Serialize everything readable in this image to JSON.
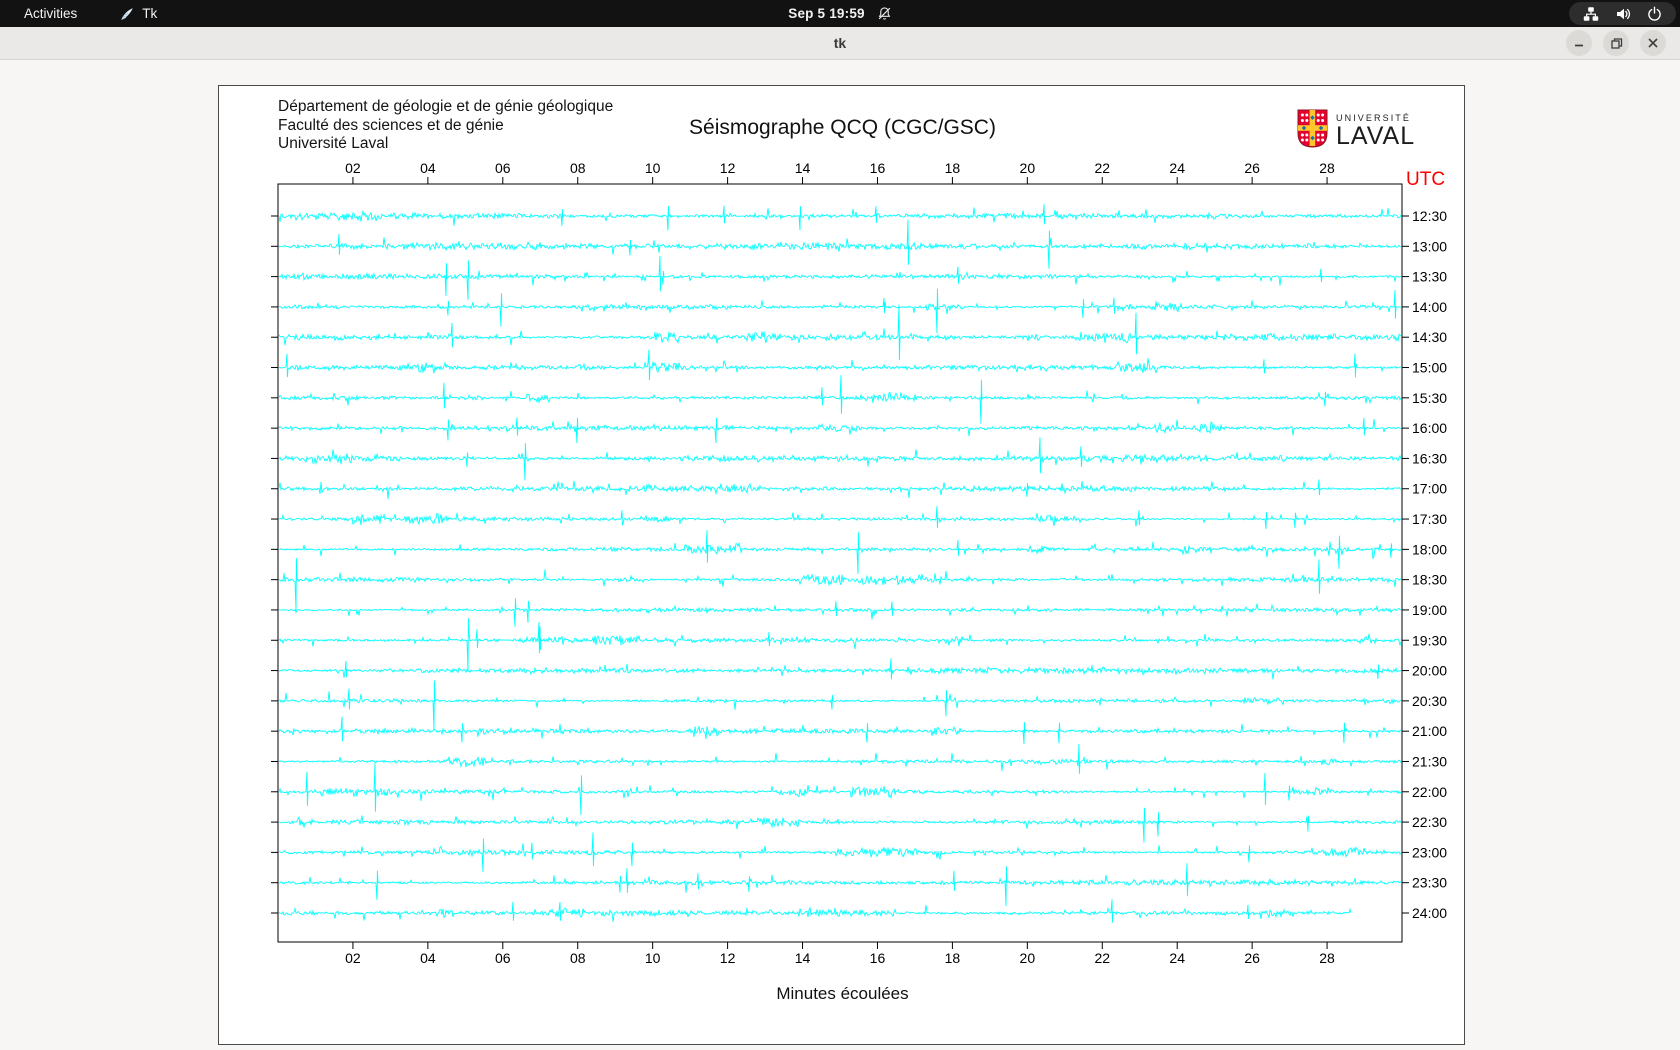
{
  "topbar": {
    "activities_label": "Activities",
    "app_menu_label": "Tk",
    "clock": "Sep 5 19:59",
    "icons": [
      "tk-feather-icon",
      "bell-muted-icon",
      "network-tree-icon",
      "speaker-icon",
      "power-icon"
    ]
  },
  "titlebar": {
    "title": "tk",
    "buttons": [
      "minimize",
      "maximize",
      "close"
    ]
  },
  "window": {
    "header_lines": [
      "Département de géologie et de génie géologique",
      "Faculté des sciences et de génie",
      "Université Laval"
    ],
    "chart_title": "Séismographe QCQ (CGC/GSC)",
    "logo_top": "UNIVERSITÉ",
    "logo_bottom": "LAVAL",
    "utc_label": "UTC",
    "x_axis_label": "Minutes écoulées"
  },
  "chart_data": {
    "type": "line",
    "subtype": "helicorder-seismogram",
    "title": "Séismographe QCQ (CGC/GSC)",
    "xlabel": "Minutes écoulées",
    "x_range_minutes": [
      0,
      30
    ],
    "x_ticks": [
      "02",
      "04",
      "06",
      "08",
      "10",
      "12",
      "14",
      "16",
      "18",
      "20",
      "22",
      "24",
      "26",
      "28"
    ],
    "row_labels_utc": [
      "12:30",
      "13:00",
      "13:30",
      "14:00",
      "14:30",
      "15:00",
      "15:30",
      "16:00",
      "16:30",
      "17:00",
      "17:30",
      "18:00",
      "18:30",
      "19:00",
      "19:30",
      "20:00",
      "20:30",
      "21:00",
      "21:30",
      "22:00",
      "22:30",
      "23:00",
      "23:30",
      "24:00"
    ],
    "rows": 24,
    "minutes_per_row": 30,
    "last_row_completion": 0.955,
    "grid": false,
    "legend": null,
    "description": "24 stacked 30-minute seismic noise traces with random spikes; each row ends at the UTC time labelled on the right axis; last row still being written.",
    "colors": {
      "trace": "#00FFFF",
      "utc_label": "#FF0000",
      "axis": "#000000",
      "logo_red": "#E4032E",
      "logo_yellow": "#FFC72C",
      "logo_blue": "#1A6EB5"
    }
  }
}
